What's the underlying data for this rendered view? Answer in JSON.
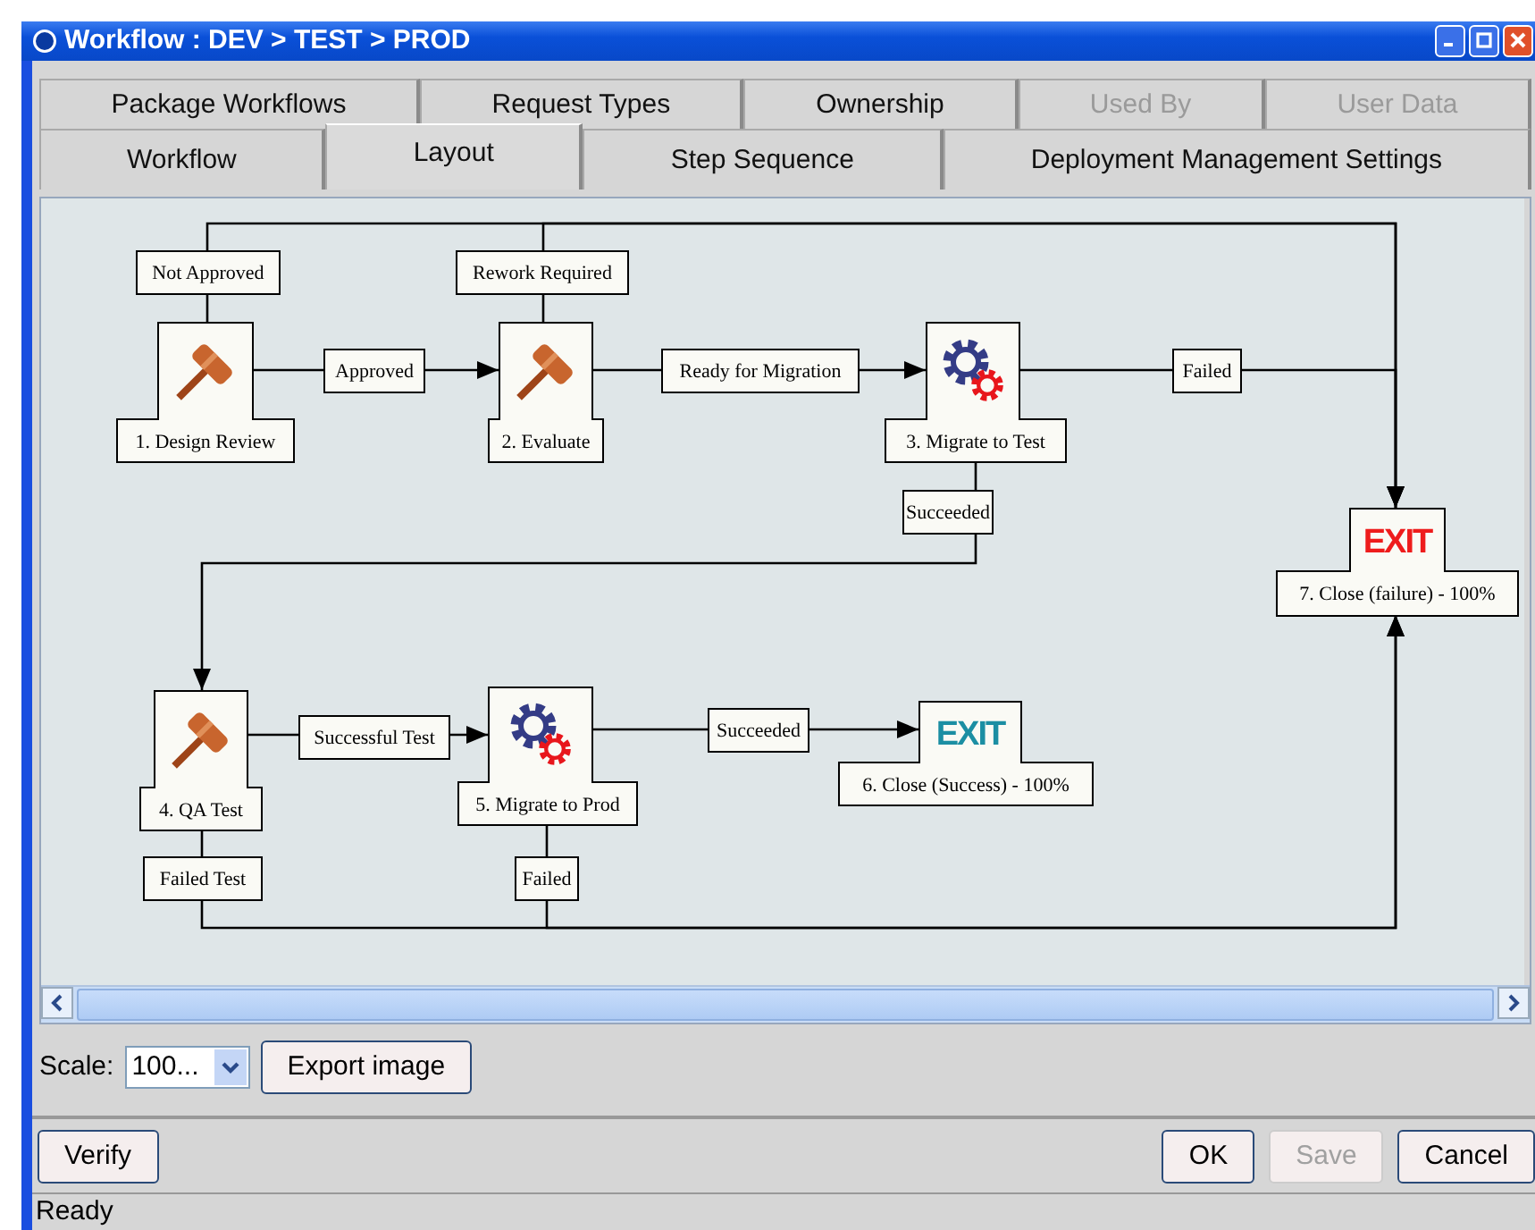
{
  "window": {
    "title": "Workflow : DEV > TEST > PROD"
  },
  "tab_rows": [
    [
      {
        "label": "Package Workflows",
        "selected": false,
        "disabled": false
      },
      {
        "label": "Request Types",
        "selected": false,
        "disabled": false
      },
      {
        "label": "Ownership",
        "selected": false,
        "disabled": false
      },
      {
        "label": "Used By",
        "selected": false,
        "disabled": true
      },
      {
        "label": "User Data",
        "selected": false,
        "disabled": true
      }
    ],
    [
      {
        "label": "Workflow",
        "selected": false,
        "disabled": false
      },
      {
        "label": "Layout",
        "selected": true,
        "disabled": false
      },
      {
        "label": "Step Sequence",
        "selected": false,
        "disabled": false
      },
      {
        "label": "Deployment Management Settings",
        "selected": false,
        "disabled": false
      }
    ]
  ],
  "diagram": {
    "steps": [
      {
        "label": "1. Design Review",
        "kind": "decision"
      },
      {
        "label": "2. Evaluate",
        "kind": "decision"
      },
      {
        "label": "3. Migrate to Test",
        "kind": "execution"
      },
      {
        "label": "4. QA Test",
        "kind": "decision"
      },
      {
        "label": "5. Migrate to Prod",
        "kind": "execution"
      },
      {
        "label": "6. Close (Success) - 100%",
        "kind": "close",
        "icon_text": "EXIT",
        "color": "#1b8ea3"
      },
      {
        "label": "7. Close (failure) - 100%",
        "kind": "close",
        "icon_text": "EXIT",
        "color": "#ee1c1c"
      }
    ],
    "transitions": [
      {
        "label": "Not Approved"
      },
      {
        "label": "Rework Required"
      },
      {
        "label": "Approved"
      },
      {
        "label": "Ready for Migration"
      },
      {
        "label": "Failed"
      },
      {
        "label": "Succeeded"
      },
      {
        "label": "Successful Test"
      },
      {
        "label": "Succeeded"
      },
      {
        "label": "Failed Test"
      },
      {
        "label": "Failed"
      }
    ]
  },
  "scale": {
    "label": "Scale:",
    "value": "100..."
  },
  "export_button": "Export image",
  "verify_button": "Verify",
  "buttons": [
    {
      "label": "OK",
      "disabled": false
    },
    {
      "label": "Save",
      "disabled": true
    },
    {
      "label": "Cancel",
      "disabled": false
    }
  ],
  "status_bar": "Ready"
}
